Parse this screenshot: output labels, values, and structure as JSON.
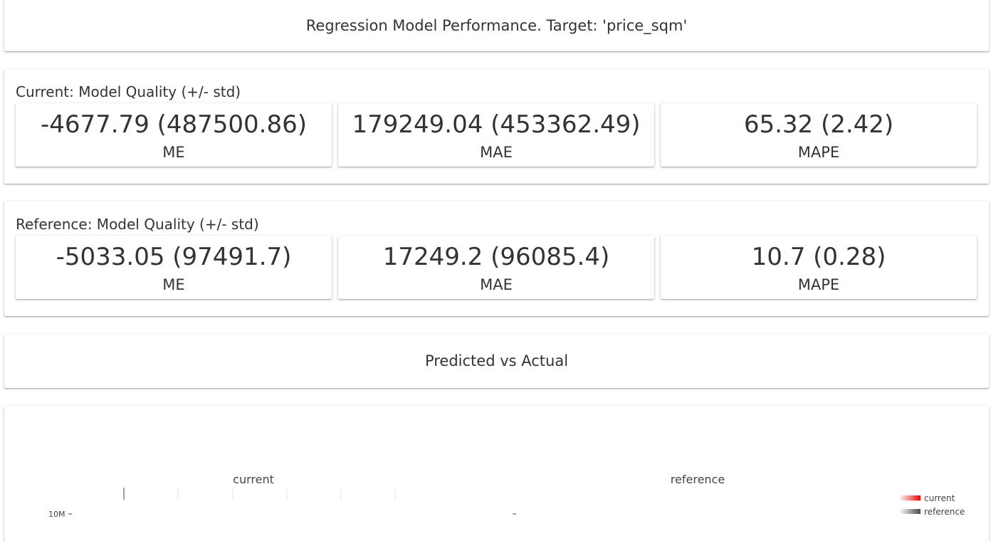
{
  "header": {
    "title": "Regression Model Performance. Target: 'price_sqm'"
  },
  "current_quality": {
    "label": "Current: Model Quality (+/- std)",
    "metrics": [
      {
        "value": "-4677.79 (487500.86)",
        "name": "ME"
      },
      {
        "value": "179249.04 (453362.49)",
        "name": "MAE"
      },
      {
        "value": "65.32 (2.42)",
        "name": "MAPE"
      }
    ]
  },
  "reference_quality": {
    "label": "Reference: Model Quality (+/- std)",
    "metrics": [
      {
        "value": "-5033.05 (97491.7)",
        "name": "ME"
      },
      {
        "value": "17249.2 (96085.4)",
        "name": "MAE"
      },
      {
        "value": "10.7 (0.28)",
        "name": "MAPE"
      }
    ]
  },
  "predicted_vs_actual": {
    "title": "Predicted vs Actual"
  },
  "chart_data": {
    "type": "scatter",
    "subplots": [
      {
        "title": "current"
      },
      {
        "title": "reference"
      }
    ],
    "y_tick_labels": [
      "10M"
    ],
    "legend": {
      "placement": "right",
      "entries": [
        {
          "name": "current",
          "color": "#ed0400"
        },
        {
          "name": "reference",
          "color": "#4d4d4d"
        }
      ]
    },
    "series": [
      {
        "name": "current",
        "values": []
      },
      {
        "name": "reference",
        "values": []
      }
    ]
  },
  "colors": {
    "current": "#ed0400",
    "reference": "#4d4d4d"
  }
}
